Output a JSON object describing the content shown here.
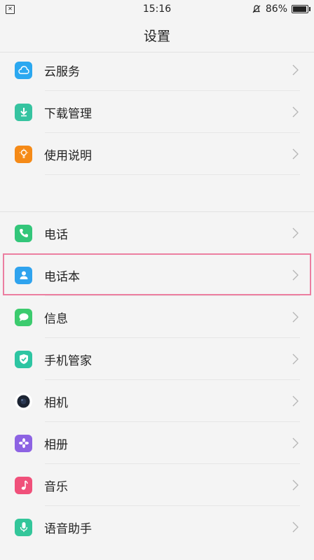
{
  "status_bar": {
    "time": "15:16",
    "battery": "86%"
  },
  "header": {
    "title": "设置"
  },
  "group1": [
    {
      "label": "云服务",
      "icon": "cloud-icon",
      "color": "#2ba8f0"
    },
    {
      "label": "下载管理",
      "icon": "download-icon",
      "color": "#36c3a0"
    },
    {
      "label": "使用说明",
      "icon": "lightbulb-icon",
      "color": "#f58a17"
    }
  ],
  "group2": [
    {
      "label": "电话",
      "icon": "phone-icon",
      "color": "#33c67a"
    },
    {
      "label": "电话本",
      "icon": "contacts-icon",
      "color": "#2fa3ee"
    },
    {
      "label": "信息",
      "icon": "message-icon",
      "color": "#3ccb6e"
    },
    {
      "label": "手机管家",
      "icon": "shield-icon",
      "color": "#2dc5a2"
    },
    {
      "label": "相机",
      "icon": "camera-icon",
      "color": "#1c2433"
    },
    {
      "label": "相册",
      "icon": "flower-icon",
      "color": "#8d63e3"
    },
    {
      "label": "音乐",
      "icon": "music-note-icon",
      "color": "#f0507a"
    },
    {
      "label": "语音助手",
      "icon": "microphone-icon",
      "color": "#33c69a"
    }
  ]
}
